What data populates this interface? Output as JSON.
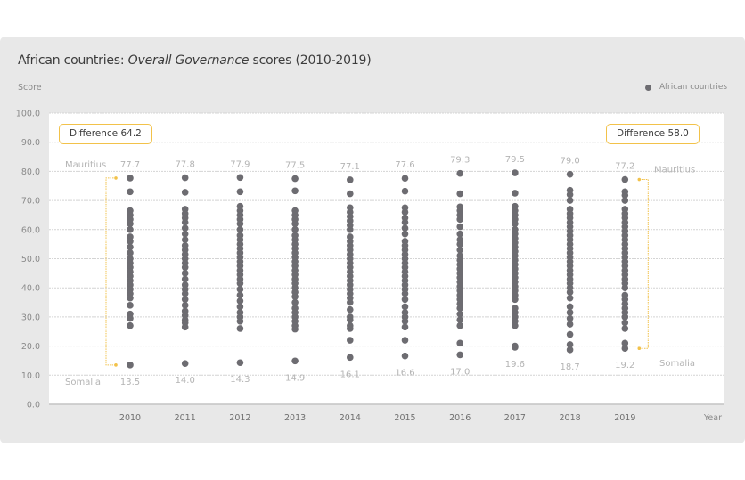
{
  "chart_data": {
    "type": "scatter",
    "title_prefix": "African countries: ",
    "title_italic": "Overall Governance",
    "title_suffix": " scores (2010-2019)",
    "ylabel": "Score",
    "xlabel": "Year",
    "ylim": [
      0,
      100
    ],
    "yticks": [
      "0.0",
      "10.0",
      "20.0",
      "30.0",
      "40.0",
      "50.0",
      "60.0",
      "70.0",
      "80.0",
      "90.0",
      "100.0"
    ],
    "grid": true,
    "legend": {
      "label": "African countries",
      "position": "top-right"
    },
    "colors": {
      "points": "#6d6c71",
      "annotation": "#f2c24a",
      "card": "#e8e8e8",
      "plot": "#ffffff"
    },
    "categories": [
      "2010",
      "2011",
      "2012",
      "2013",
      "2014",
      "2015",
      "2016",
      "2017",
      "2018",
      "2019"
    ],
    "max_values": [
      "77.7",
      "77.8",
      "77.9",
      "77.5",
      "77.1",
      "77.6",
      "79.3",
      "79.5",
      "79.0",
      "77.2"
    ],
    "min_values": [
      "13.5",
      "14.0",
      "14.3",
      "14.9",
      "16.1",
      "16.6",
      "17.0",
      "19.6",
      "18.7",
      "19.2"
    ],
    "max_label": "Mauritius",
    "min_label": "Somalia",
    "annotations": [
      {
        "label": "Difference 64.2",
        "year": "2010"
      },
      {
        "label": "Difference 58.0",
        "year": "2019"
      }
    ],
    "series": [
      {
        "name": "2010",
        "values": [
          77.7,
          73,
          66.5,
          65,
          63.5,
          62,
          60,
          57.5,
          56,
          54,
          52,
          50,
          48.5,
          47,
          45.5,
          44,
          42.5,
          41,
          39.5,
          38,
          36.5,
          34,
          31,
          29.5,
          27,
          13.5
        ]
      },
      {
        "name": "2011",
        "values": [
          77.8,
          72.8,
          67,
          65.5,
          64,
          62.5,
          60.5,
          58.5,
          56.5,
          54.5,
          53,
          51.5,
          50,
          48.5,
          47,
          45,
          43,
          41,
          39.5,
          38,
          36,
          34,
          32,
          30.5,
          29,
          28,
          26.5,
          14.0
        ]
      },
      {
        "name": "2012",
        "values": [
          77.9,
          73,
          68,
          66.5,
          65,
          63.5,
          62,
          60,
          58,
          56.5,
          55,
          53.5,
          52,
          50.5,
          49,
          47.5,
          46,
          44.5,
          43,
          41.5,
          39.5,
          37.5,
          35.5,
          33.5,
          31.5,
          30,
          28.5,
          26,
          14.3
        ]
      },
      {
        "name": "2013",
        "values": [
          77.5,
          73.3,
          66.5,
          65,
          63.5,
          62,
          60,
          58,
          56.5,
          55,
          53.5,
          52,
          50.5,
          49,
          47.5,
          46,
          44.5,
          43,
          41.5,
          40,
          38.5,
          37,
          35,
          33,
          31.5,
          30,
          28.5,
          27,
          25.8,
          14.9
        ]
      },
      {
        "name": "2014",
        "values": [
          77.1,
          72.3,
          67.5,
          66,
          64.5,
          63,
          61.5,
          60,
          57.5,
          56,
          54.5,
          53,
          51.5,
          50,
          48.5,
          47,
          45.5,
          44,
          42.5,
          41,
          39.5,
          38,
          36.5,
          35,
          32.5,
          30,
          29,
          27,
          26,
          22,
          16.1
        ]
      },
      {
        "name": "2015",
        "values": [
          77.6,
          73.2,
          67.5,
          66,
          64,
          62.5,
          60.5,
          58.5,
          56,
          54.5,
          53,
          51.5,
          50,
          48.5,
          47,
          45.5,
          44,
          42.5,
          41,
          39.5,
          38,
          36,
          33.5,
          31.5,
          30,
          28.5,
          26.5,
          22,
          16.6
        ]
      },
      {
        "name": "2016",
        "values": [
          79.3,
          72.3,
          67.8,
          66.5,
          65,
          63.5,
          61,
          58.5,
          56.5,
          55,
          53,
          51,
          49.5,
          48,
          46.5,
          45,
          43.5,
          42,
          40.5,
          39,
          37.5,
          36,
          34.5,
          33,
          31,
          29,
          27,
          21,
          17.0
        ]
      },
      {
        "name": "2017",
        "values": [
          79.5,
          72.5,
          68,
          66.5,
          65,
          63.5,
          62,
          60,
          58.5,
          57,
          55.5,
          54,
          52.5,
          51,
          49.5,
          48,
          46.5,
          45,
          43.5,
          42,
          40.5,
          39,
          37.5,
          36,
          33,
          31.5,
          30,
          28.5,
          27,
          20,
          19.6
        ]
      },
      {
        "name": "2018",
        "values": [
          79.0,
          73.5,
          72,
          70,
          67,
          65.5,
          64,
          62.5,
          61,
          59.5,
          58,
          56.5,
          55,
          53.5,
          52,
          50.5,
          49,
          47.5,
          46,
          44.5,
          43,
          41.5,
          40,
          38.5,
          36.5,
          33.5,
          31.5,
          29.5,
          27.5,
          24,
          20.5,
          18.7
        ]
      },
      {
        "name": "2019",
        "values": [
          77.2,
          73,
          71.8,
          70,
          67,
          65.5,
          64,
          62.5,
          61,
          59.5,
          58,
          56.5,
          55,
          53.5,
          52,
          50.5,
          49,
          47.5,
          46,
          44.5,
          43,
          41.5,
          40,
          37.5,
          36,
          34.5,
          33,
          31.5,
          30,
          28,
          26,
          21,
          19.2
        ]
      }
    ]
  }
}
